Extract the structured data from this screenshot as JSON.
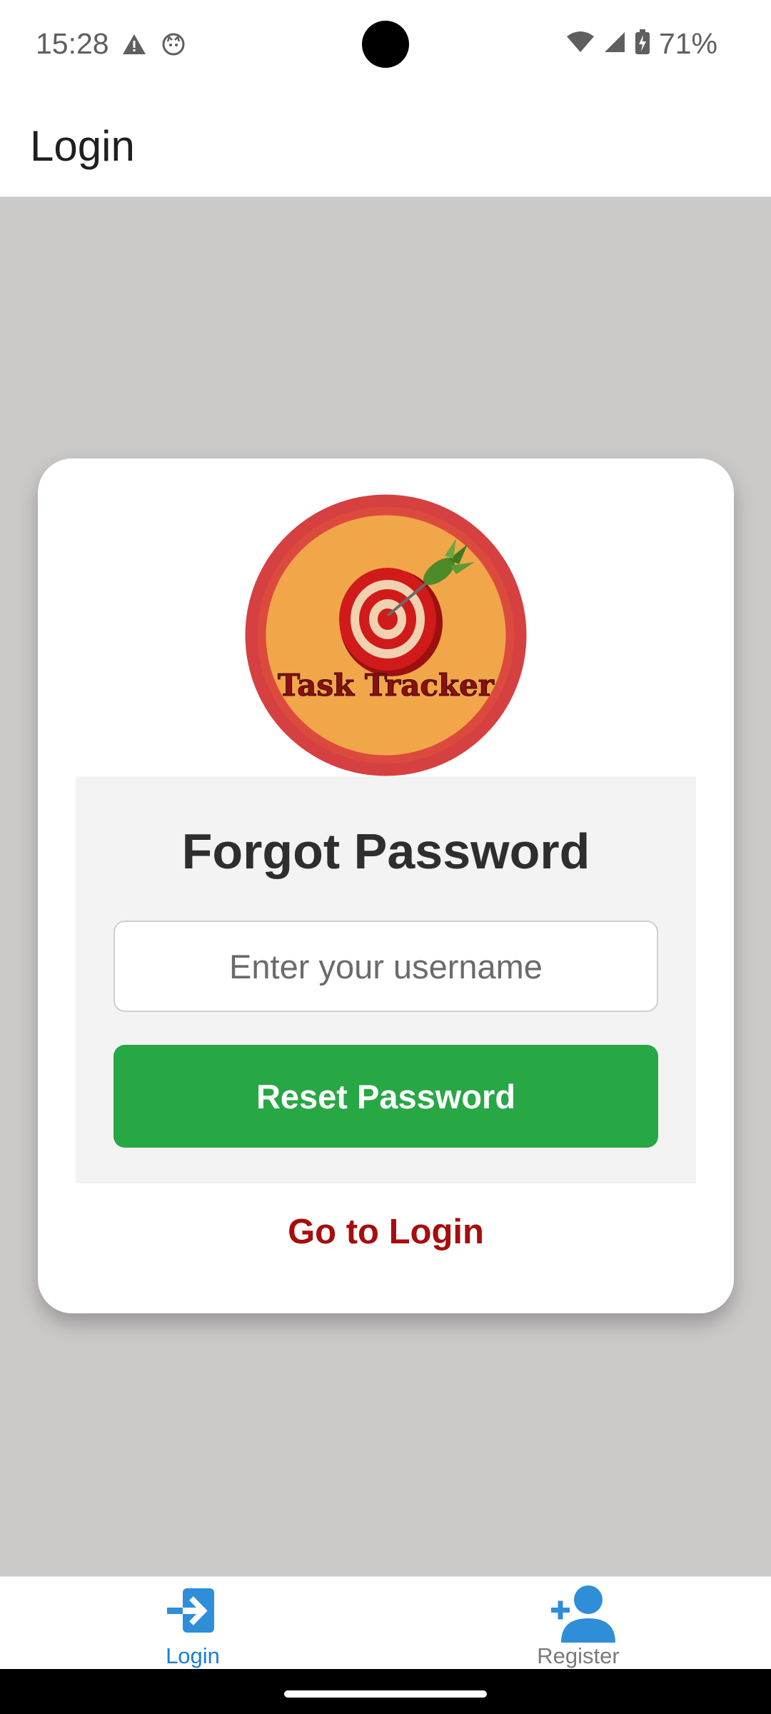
{
  "status_bar": {
    "time": "15:28",
    "battery": "71%",
    "icons": [
      "warning-icon",
      "cat-face-icon",
      "wifi-icon",
      "signal-icon",
      "battery-charging-icon"
    ]
  },
  "app_bar": {
    "title": "Login"
  },
  "logo": {
    "text": "Task Tracker",
    "colors": {
      "ring": "#d64040",
      "fill": "#f2a64a",
      "target_red": "#d11a1a",
      "dart_green": "#4e8a2a"
    }
  },
  "form": {
    "title": "Forgot Password",
    "username_placeholder": "Enter your username",
    "username_value": "",
    "submit_label": "Reset Password",
    "goto_login_label": "Go to Login"
  },
  "bottom_nav": {
    "items": [
      {
        "label": "Login",
        "icon": "login-arrow-icon",
        "active": true
      },
      {
        "label": "Register",
        "icon": "add-user-icon",
        "active": false
      }
    ]
  },
  "colors": {
    "accent_blue": "#1a7fd6",
    "button_green": "#28a745",
    "link_red": "#a60d0d",
    "background": "#ccc9c9"
  }
}
